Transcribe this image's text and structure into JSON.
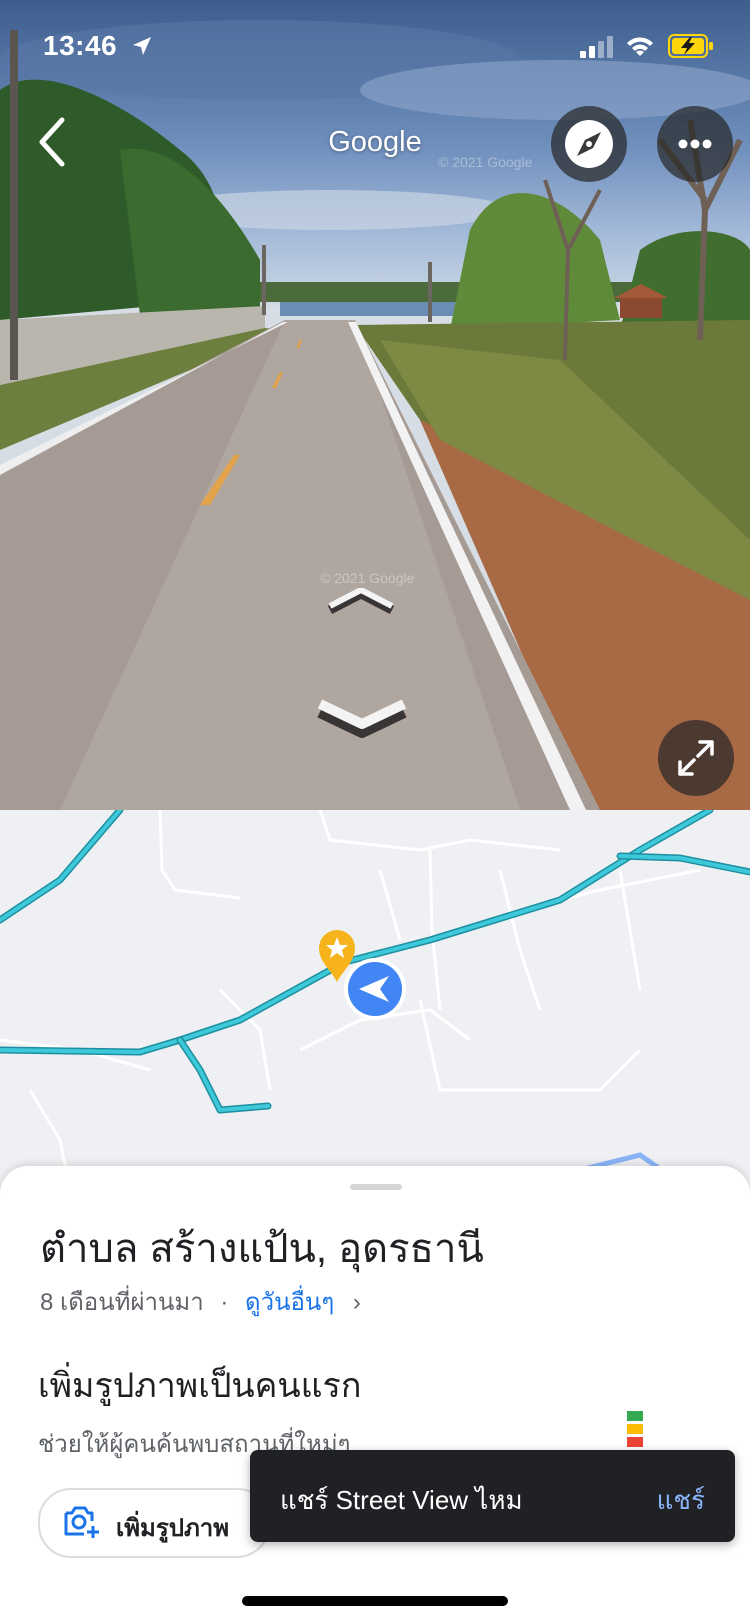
{
  "status_bar": {
    "time": "13:46",
    "icons": [
      "location-arrow-icon",
      "cellular-signal-icon",
      "wifi-icon",
      "battery-charging-icon"
    ],
    "battery_color": "#ffd60a"
  },
  "street_view": {
    "title": "Google",
    "watermark": "© 2021 Google",
    "buttons": [
      "back-chevron-icon",
      "compass-icon",
      "more-options-icon",
      "expand-icon"
    ],
    "navigation": [
      "move-forward-chevron-icon",
      "move-backward-chevron-icon"
    ]
  },
  "map": {
    "road_color": "#26b3c5",
    "pin_color": "#f6b31b",
    "location_color": "#4285f4",
    "icons": [
      "starred-place-pin-icon",
      "current-heading-arrow-icon"
    ]
  },
  "place": {
    "title": "ตำบล สร้างแป้น, อุดรธานี",
    "date": "8 เดือนที่ผ่านมา",
    "separator": "·",
    "see_other_link": "ดูวันอื่นๆ",
    "chevron": "›"
  },
  "add_photo": {
    "title": "เพิ่มรูปภาพเป็นคนแรก",
    "subtitle": "ช่วยให้ผู้คนค้นพบสถานที่ใหม่ๆ",
    "button_label": "เพิ่มรูปภาพ",
    "accent_colors": [
      "#34a853",
      "#fbbc04",
      "#ea4335",
      "#4285f4"
    ]
  },
  "snackbar": {
    "text": "แชร์ Street View ไหม",
    "action": "แชร์"
  }
}
